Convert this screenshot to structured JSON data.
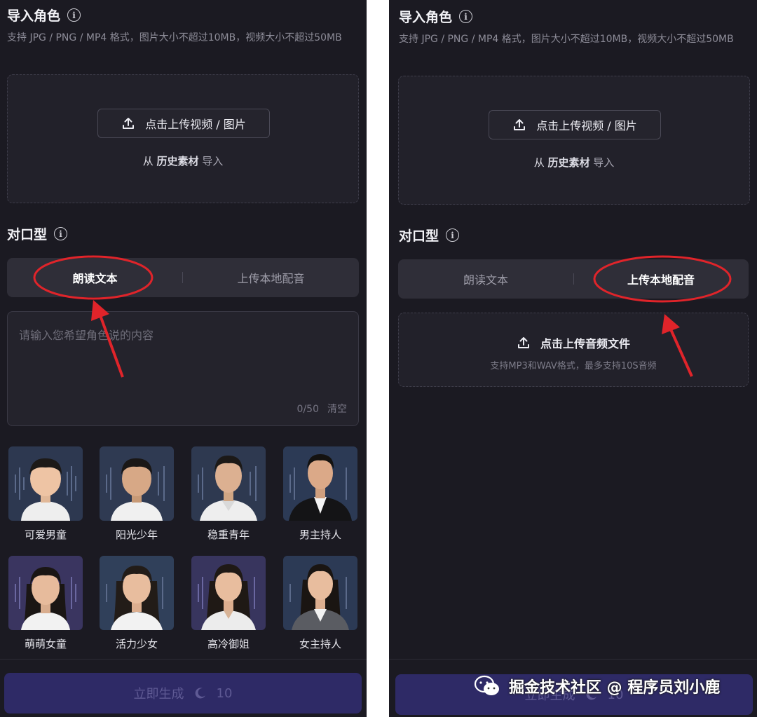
{
  "import_section": {
    "title": "导入角色",
    "description": "支持 JPG / PNG / MP4 格式，图片大小不超过10MB，视频大小不超过50MB",
    "upload_label": "点击上传视频 / 图片",
    "history_prefix": "从",
    "history_link": "历史素材",
    "history_suffix": "导入"
  },
  "lipsync_section": {
    "title": "对口型",
    "tabs": [
      "朗读文本",
      "上传本地配音"
    ]
  },
  "text_input": {
    "placeholder": "请输入您希望角色说的内容",
    "counter": "0/50",
    "clear_label": "清空"
  },
  "voices": [
    {
      "label": "可爱男童"
    },
    {
      "label": "阳光少年"
    },
    {
      "label": "稳重青年"
    },
    {
      "label": "男主持人"
    },
    {
      "label": "萌萌女童"
    },
    {
      "label": "活力少女"
    },
    {
      "label": "高冷御姐"
    },
    {
      "label": "女主持人"
    }
  ],
  "audio_upload": {
    "label": "点击上传音频文件",
    "hint": "支持MP3和WAV格式，最多支持10S音频"
  },
  "generate": {
    "label": "立即生成",
    "cost": "10"
  },
  "watermark": {
    "text": "掘金技术社区 @ 程序员刘小鹿"
  },
  "colors": {
    "background": "#1b1a22",
    "annotation": "#e0242a",
    "button": "#2e2a66"
  }
}
